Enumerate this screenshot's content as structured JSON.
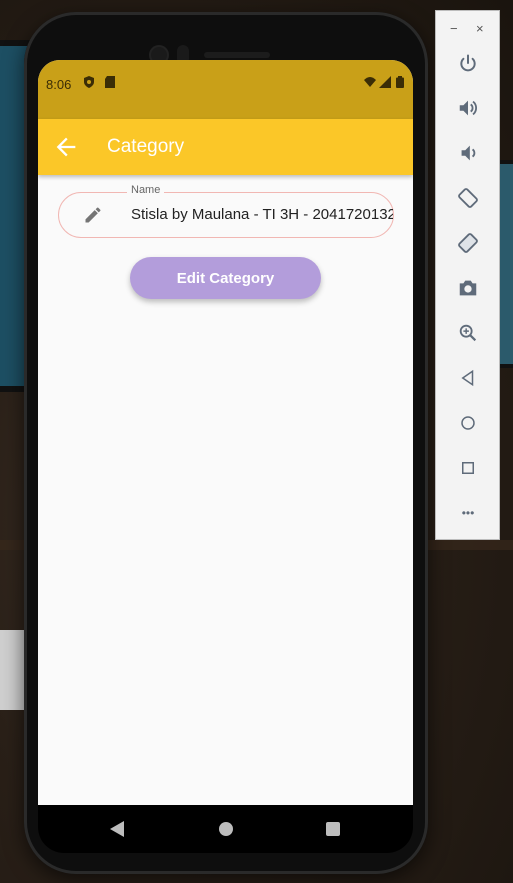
{
  "status_bar": {
    "time": "8:06"
  },
  "app_bar": {
    "title": "Category"
  },
  "form": {
    "name_label": "Name",
    "name_value": "Stisla by Maulana - TI 3H - 2041720132",
    "submit_label": "Edit Category"
  },
  "emulator_toolbar": {
    "minimize": "−",
    "close": "×",
    "more": "•••",
    "items": [
      "power-icon",
      "volume-up-icon",
      "volume-down-icon",
      "rotate-left-icon",
      "rotate-right-icon",
      "camera-icon",
      "zoom-icon",
      "back-icon",
      "home-icon",
      "overview-icon",
      "more-icon"
    ]
  },
  "colors": {
    "status_bar": "#c9a018",
    "app_bar": "#fbc728",
    "button": "#b39ddb",
    "field_border": "#f1b7b3"
  }
}
